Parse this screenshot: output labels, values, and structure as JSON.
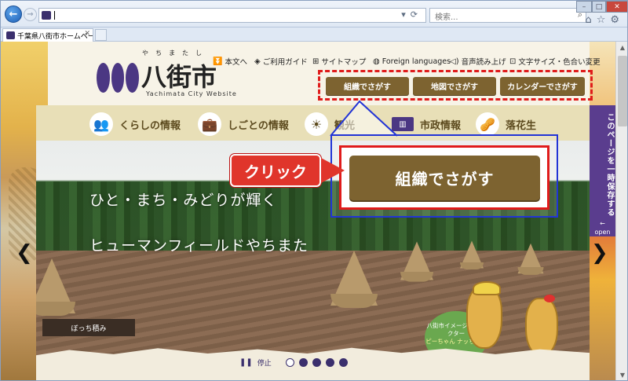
{
  "browser": {
    "url_value": "",
    "search_placeholder": "検索...",
    "tab_title": "千葉県八街市ホームペー...",
    "window_controls": [
      "minimize",
      "maximize",
      "close"
    ]
  },
  "site": {
    "logo": {
      "ruby": "やちまたし",
      "name": "八街市",
      "en": "Yachimata City Website"
    },
    "utility_links": [
      {
        "icon": "arrow-down-icon",
        "label": "本文へ"
      },
      {
        "icon": "guide-icon",
        "label": "ご利用ガイド"
      },
      {
        "icon": "sitemap-icon",
        "label": "サイトマップ"
      },
      {
        "icon": "globe-icon",
        "label": "Foreign languages"
      },
      {
        "icon": "speaker-icon",
        "label": "音声読み上げ"
      },
      {
        "icon": "text-size-icon",
        "label": "文字サイズ・色合い変更"
      }
    ],
    "search_buttons": [
      "組織でさがす",
      "地図でさがす",
      "カレンダーでさがす"
    ],
    "nav": [
      {
        "icon": "people-icon",
        "label": "くらしの情報"
      },
      {
        "icon": "briefcase-icon",
        "label": "しごとの情報"
      },
      {
        "icon": "sun-icon",
        "label": "観光"
      },
      {
        "icon": "building-icon",
        "label": "市政情報"
      },
      {
        "icon": "peanut-icon",
        "label": "落花生"
      }
    ],
    "hero": {
      "line1": "ひと・まち・みどりが輝く",
      "line2": "ヒューマンフィールドやちまた",
      "caption": "ぼっち積み",
      "pause_label": "停止",
      "slide_count": 5,
      "current_slide": 1
    },
    "mascot": {
      "title": "八街市イメージキャラクター",
      "names": "ピーちゃん ナッちゃん"
    },
    "side_tab": {
      "label": "このページを一時保存する",
      "open_label": "open"
    }
  },
  "annotation": {
    "click_label": "クリック",
    "zoomed_button": "組織でさがす"
  },
  "colors": {
    "brand_purple": "#3b2f6d",
    "button_brown": "#7d6330",
    "highlight_red": "#e01b1b",
    "callout_blue": "#2234d6"
  }
}
